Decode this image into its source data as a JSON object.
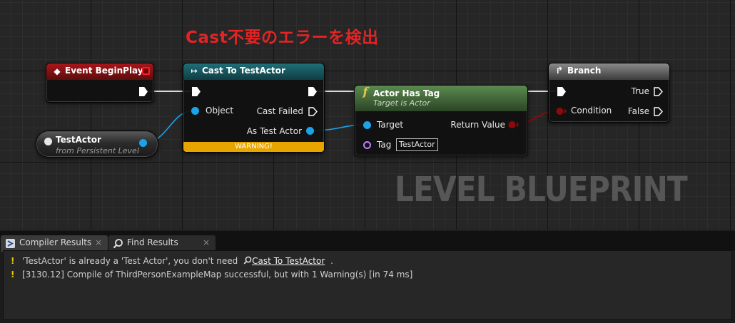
{
  "annotation": "Cast不要のエラーを検出",
  "watermark": "LEVEL BLUEPRINT",
  "nodes": {
    "event": {
      "title": "Event BeginPlay"
    },
    "cast": {
      "title": "Cast To TestActor",
      "object_label": "Object",
      "cast_failed_label": "Cast Failed",
      "as_label": "As Test Actor",
      "warning": "WARNING!"
    },
    "hastag": {
      "title": "Actor Has Tag",
      "subtitle": "Target is Actor",
      "target_label": "Target",
      "tag_label": "Tag",
      "tag_value": "TestActor",
      "return_label": "Return Value"
    },
    "branch": {
      "title": "Branch",
      "true_label": "True",
      "condition_label": "Condition",
      "false_label": "False"
    },
    "testactor": {
      "title": "TestActor",
      "subtitle": "from Persistent Level"
    }
  },
  "tabs": [
    {
      "label": "Compiler Results"
    },
    {
      "label": "Find Results"
    }
  ],
  "tab_close": "×",
  "messages": [
    {
      "text": "'TestActor' is already a 'Test Actor', you don't need",
      "link": "Cast To TestActor",
      "suffix": "."
    },
    {
      "text": "[3130.12] Compile of ThirdPersonExampleMap successful, but with 1 Warning(s) [in 74 ms]"
    }
  ],
  "colors": {
    "annotation": "#e42424",
    "object_pin": "#1aa3e8",
    "bool_pin": "#8c0a0a",
    "name_pin": "#c37cff",
    "warning": "#e7a500"
  }
}
